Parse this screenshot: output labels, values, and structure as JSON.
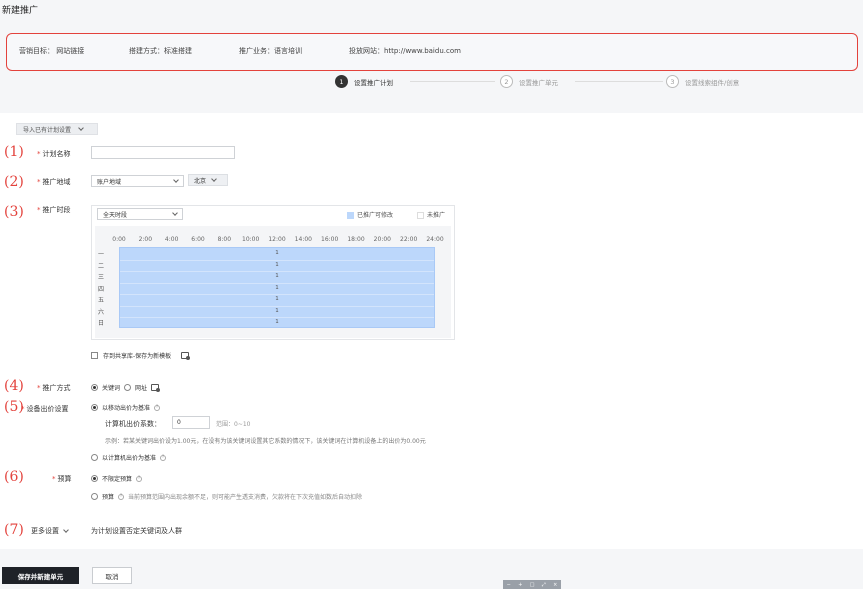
{
  "page_title": "新建推广",
  "info": {
    "goal": "营销目标：  网站链接",
    "method": "搭建方式：标准搭建",
    "business": "推广业务：语言培训",
    "site": "投放网站：http://www.baidu.com"
  },
  "steps": [
    {
      "num": "1",
      "label": "设置推广计划"
    },
    {
      "num": "2",
      "label": "设置推广单元"
    },
    {
      "num": "3",
      "label": "设置线索组件/创意"
    }
  ],
  "import_btn": "导入已有计划设置",
  "markers": [
    "(1)",
    "(2)",
    "(3)",
    "(4)",
    "(5)",
    "(6)",
    "(7)"
  ],
  "fields": {
    "plan_name": {
      "label": "计划名称",
      "value": ""
    },
    "region": {
      "label": "推广地域",
      "select": "账户地域",
      "tag": "北京"
    },
    "schedule": {
      "label": "推广时段",
      "select": "全天时段",
      "legend_on": "已推广可修改",
      "legend_off": "未推广"
    },
    "share": "存到共享库-保存为新模板",
    "promo_mode": {
      "label": "推广方式",
      "opt1": "关键词",
      "opt2": "网址"
    },
    "device_bid": {
      "label": "设备出价设置",
      "opt1": "以移动出价为基准",
      "coef_label": "计算机出价系数：",
      "coef_value": "0",
      "range": "范围：0~10",
      "example": "示例：若某关键词出价设为1.00元，在没有为该关键词设置其它系数的情况下，该关键词在计算机设备上的出价为0.00元",
      "opt2": "以计算机出价为基准"
    },
    "budget": {
      "label": "预算",
      "opt1": "不限定预算",
      "opt2": "预算",
      "note": "当前预算范围内出现余额不足，则可能产生透支消费，欠款将在下次充值如数后自动扣除"
    },
    "more": {
      "label": "更多设置",
      "desc": "为计划设置否定关键词及人群"
    }
  },
  "schedule_hours": [
    "0:00",
    "2:00",
    "4:00",
    "6:00",
    "8:00",
    "10:00",
    "12:00",
    "14:00",
    "16:00",
    "18:00",
    "20:00",
    "22:00",
    "24:00"
  ],
  "schedule_days": [
    "一",
    "二",
    "三",
    "四",
    "五",
    "六",
    "日"
  ],
  "schedule_cell": "1",
  "buttons": {
    "save": "保存并新建单元",
    "cancel": "取消"
  },
  "colors": {
    "accent": "#e3423c",
    "schedule_fill": "#bcd7fb",
    "primary_btn": "#1f2228"
  }
}
